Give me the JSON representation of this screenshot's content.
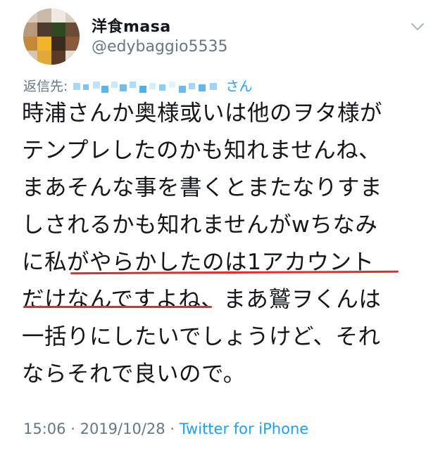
{
  "tweet": {
    "author_name": "洋食masa",
    "author_handle": "@edybaggio5535",
    "reply_prefix": "返信先:",
    "reply_suffix": "さん",
    "body_lines": [
      "時浦さんか奥様或いは他のヲタ様が",
      "テンプレしたのかも知れませんね、",
      "まあそんな事を書くとまたなりすま",
      "しされるかも知れませんがwちなみ",
      "に私がやらかしたのは1アカウント",
      "だけなんですよね、まあ鷲ヲくんは",
      "一括りにしたいでしょうけど、それ",
      "ならそれで良いので。"
    ],
    "time": "15:06",
    "date": "2019/10/28",
    "separator": "·",
    "source": "Twitter for iPhone"
  },
  "colors": {
    "text": "#14171a",
    "secondary": "#657786",
    "link": "#1da1f2",
    "underline": "#e52b2b"
  },
  "icons": {
    "more": "chevron-down-icon",
    "avatar": "pixelated-avatar"
  }
}
